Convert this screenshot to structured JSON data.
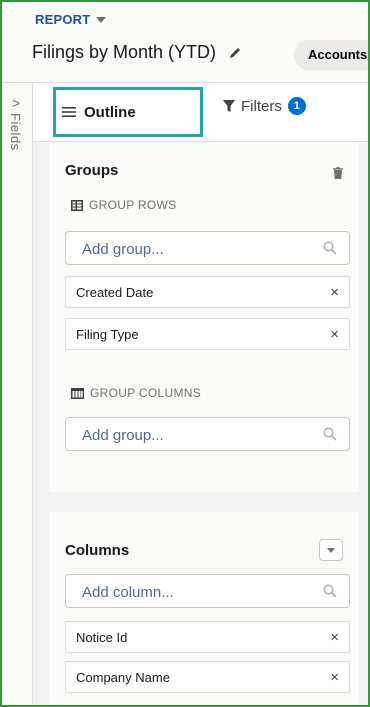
{
  "header": {
    "report_label": "REPORT",
    "title": "Filings by Month (YTD)",
    "account_pill": "Accounts"
  },
  "rail": {
    "label": "Fields",
    "chevron": ">"
  },
  "tabs": {
    "outline_label": "Outline",
    "filters_label": "Filters",
    "filters_count": "1",
    "highlight_color": "#1fa89c"
  },
  "groups": {
    "title": "Groups",
    "group_rows_label": "GROUP ROWS",
    "group_rows_placeholder": "Add group...",
    "rows": [
      "Created Date",
      "Filing Type"
    ],
    "group_columns_label": "GROUP COLUMNS",
    "group_columns_placeholder": "Add group..."
  },
  "columns": {
    "title": "Columns",
    "placeholder": "Add column...",
    "items": [
      "Notice Id",
      "Company Name"
    ]
  },
  "colors": {
    "accent": "#0070d2",
    "report_label": "#1b5297",
    "frame": "#2e9a3a"
  }
}
